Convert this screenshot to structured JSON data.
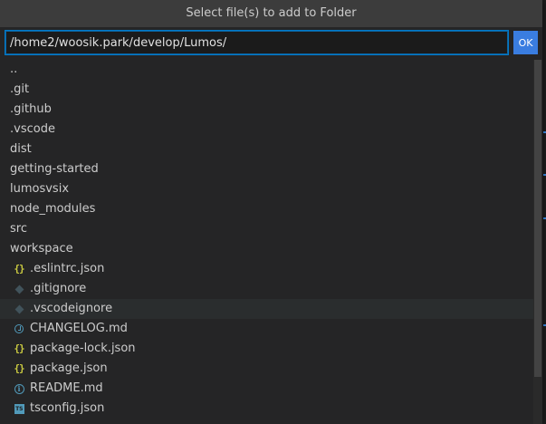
{
  "dialog": {
    "title": "Select file(s) to add to Folder",
    "path_value": "/home2/woosik.park/develop/Lumos/",
    "ok_label": "OK"
  },
  "entries": [
    {
      "label": "..",
      "kind": "folder"
    },
    {
      "label": ".git",
      "kind": "folder"
    },
    {
      "label": ".github",
      "kind": "folder"
    },
    {
      "label": ".vscode",
      "kind": "folder"
    },
    {
      "label": "dist",
      "kind": "folder"
    },
    {
      "label": "getting-started",
      "kind": "folder"
    },
    {
      "label": "lumosvsix",
      "kind": "folder"
    },
    {
      "label": "node_modules",
      "kind": "folder"
    },
    {
      "label": "src",
      "kind": "folder"
    },
    {
      "label": "workspace",
      "kind": "folder"
    },
    {
      "label": ".eslintrc.json",
      "kind": "file",
      "icon": "json-braces-icon"
    },
    {
      "label": ".gitignore",
      "kind": "file",
      "icon": "git-diamond-icon"
    },
    {
      "label": ".vscodeignore",
      "kind": "file",
      "icon": "git-diamond-icon",
      "selected": true
    },
    {
      "label": "CHANGELOG.md",
      "kind": "file",
      "icon": "clock-icon"
    },
    {
      "label": "package-lock.json",
      "kind": "file",
      "icon": "json-braces-icon"
    },
    {
      "label": "package.json",
      "kind": "file",
      "icon": "json-braces-icon"
    },
    {
      "label": "README.md",
      "kind": "file",
      "icon": "info-icon"
    },
    {
      "label": "tsconfig.json",
      "kind": "file",
      "icon": "typescript-icon"
    }
  ],
  "colors": {
    "accent": "#3a7de0",
    "json_icon": "#cbcb41",
    "info_icon": "#519aba",
    "git_icon": "#41535b"
  }
}
